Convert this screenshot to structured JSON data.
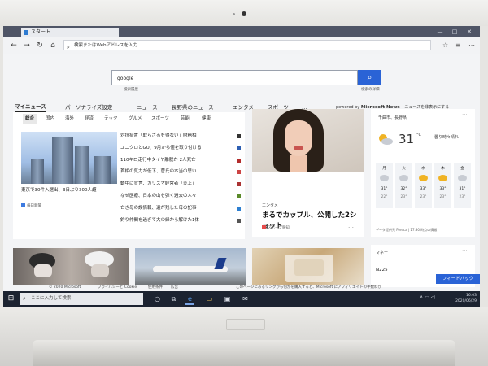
{
  "browser": {
    "tab_title": "スタート",
    "address_placeholder": "検索またはWebアドレスを入力",
    "nav": {
      "back": "←",
      "forward": "→",
      "refresh": "↻",
      "home": "⌂"
    },
    "window_controls": [
      "—",
      "□",
      "✕"
    ],
    "icons": [
      "lock-icon",
      "star-icon",
      "hub-icon",
      "share-icon",
      "more-icon"
    ]
  },
  "search": {
    "value": "google",
    "button_icon": "search-icon",
    "caption_left": "検索履歴",
    "caption_right": "検索の詳細"
  },
  "categories": {
    "items": [
      "マイニュース",
      "パーソナライズ設定",
      "ニュース",
      "長野県のニュース",
      "エンタメ",
      "スポーツ",
      "…"
    ],
    "powered_prefix": "powered by",
    "powered_brand": "Microsoft News",
    "hide_news": "ニュースを非表示にする"
  },
  "news_panel": {
    "subtabs": [
      "総合",
      "国内",
      "海外",
      "経済",
      "テック",
      "グルメ",
      "スポーツ",
      "芸能",
      "健康"
    ],
    "lead_caption": "東京で30件入選出、3日ぶり300人超",
    "lead_source": "毎日新聞",
    "headlines": [
      "対抗措置「取らざるを得ない」財務相",
      "ユニクロとGU、9月から値を取り付ける",
      "110キロ走行中タイヤ離脱か 2人死亡",
      "首相の気力が低下、菅氏の本当の思い",
      "動中に宣言、カリスマ経営者「炎上」",
      "なぜ医療、日本の山を弾く過去の人々",
      "亡き母の誤情報、遺が残した母の記事",
      "釣り仲間を過ぎて大の縁から解けた1体"
    ]
  },
  "feature": {
    "category": "エンタメ",
    "title": "まるでカップル、公開した2ショット",
    "source": "スポーツ報知",
    "more": "…"
  },
  "weather": {
    "location": "千曲市、長野県",
    "temp": "31",
    "unit": "°C",
    "description": "曇り時々晴れ",
    "forecast": [
      {
        "day": "月",
        "hi": "31°",
        "lo": "22°",
        "icon": "partly-cloudy-icon"
      },
      {
        "day": "火",
        "hi": "32°",
        "lo": "23°",
        "icon": "partly-cloudy-icon"
      },
      {
        "day": "水",
        "hi": "33°",
        "lo": "23°",
        "icon": "sunny-icon"
      },
      {
        "day": "木",
        "hi": "33°",
        "lo": "23°",
        "icon": "sunny-icon"
      },
      {
        "day": "金",
        "hi": "31°",
        "lo": "23°",
        "icon": "partly-cloudy-icon"
      }
    ],
    "footer": "データ提供元 Foreca | 17:30 時点の情報"
  },
  "market": {
    "title": "マネー",
    "index_name": "N225"
  },
  "footer": {
    "copyright": "© 2020 Microsoft",
    "links": [
      "プライバシーと Cookie",
      "使用条件",
      "広告"
    ],
    "notice": "このページにあるリンクから何かを購入すると、Microsoft にアフィリエイトの手数料が"
  },
  "feedback": {
    "label": "フィードバック"
  },
  "taskbar": {
    "search_placeholder": "ここに入力して検索",
    "icons": [
      "task-view-icon",
      "edge-icon",
      "file-explorer-icon",
      "store-icon",
      "mail-icon"
    ],
    "clock_time": "16:03",
    "clock_date": "2020/06/29"
  },
  "colors": {
    "accent": "#2a63d6",
    "taskbar": "#1c2330",
    "tabstrip": "#4f5566"
  }
}
